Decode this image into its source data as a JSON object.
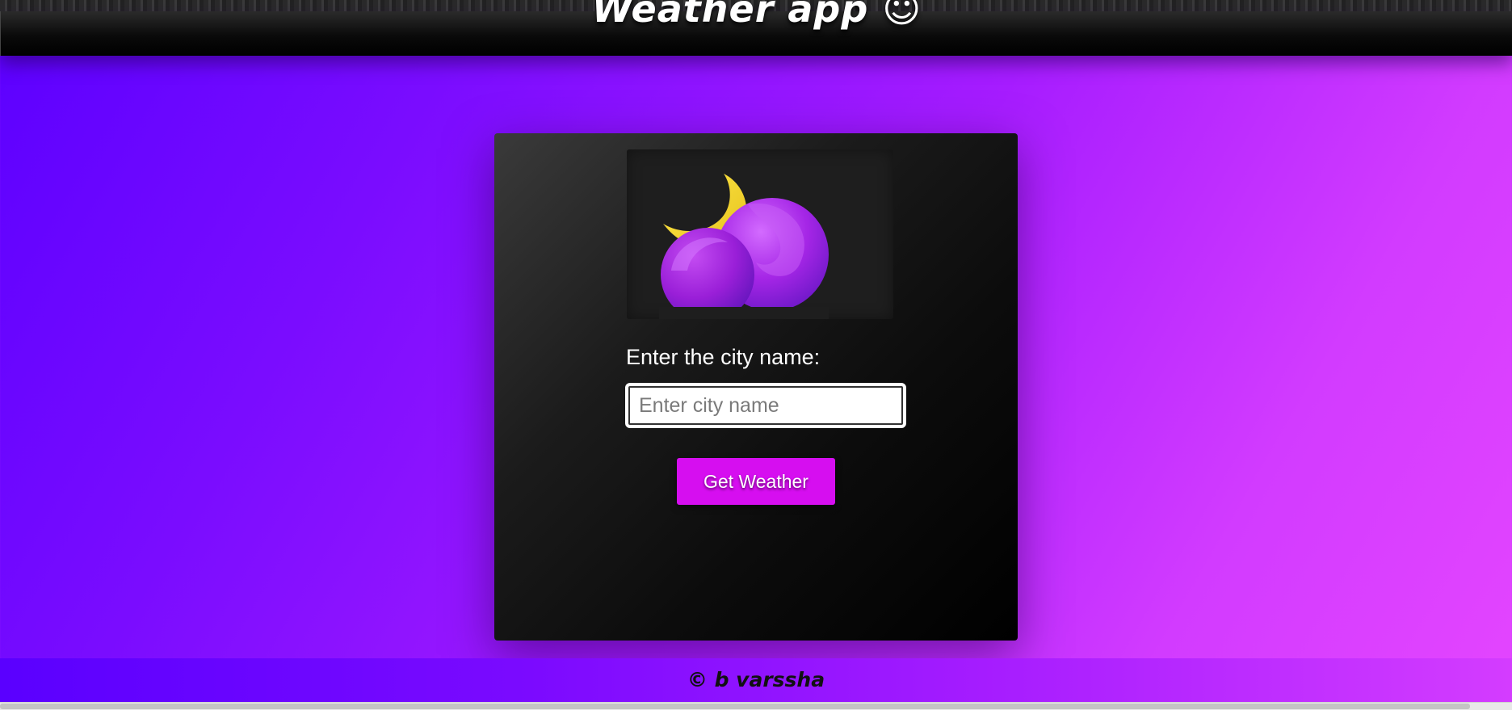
{
  "header": {
    "title": "Weather app ☺"
  },
  "card": {
    "logo_icon": "moon-and-cloud-icon",
    "city_label": "Enter the city name:",
    "city_input": {
      "value": "",
      "placeholder": "Enter city name"
    },
    "button_label": "Get Weather"
  },
  "footer": {
    "text": "© b varssha"
  },
  "colors": {
    "accent": "#d60ef0",
    "gradient_start": "#5b00ff",
    "gradient_end": "#e445ff",
    "moon": "#f1d62a"
  }
}
